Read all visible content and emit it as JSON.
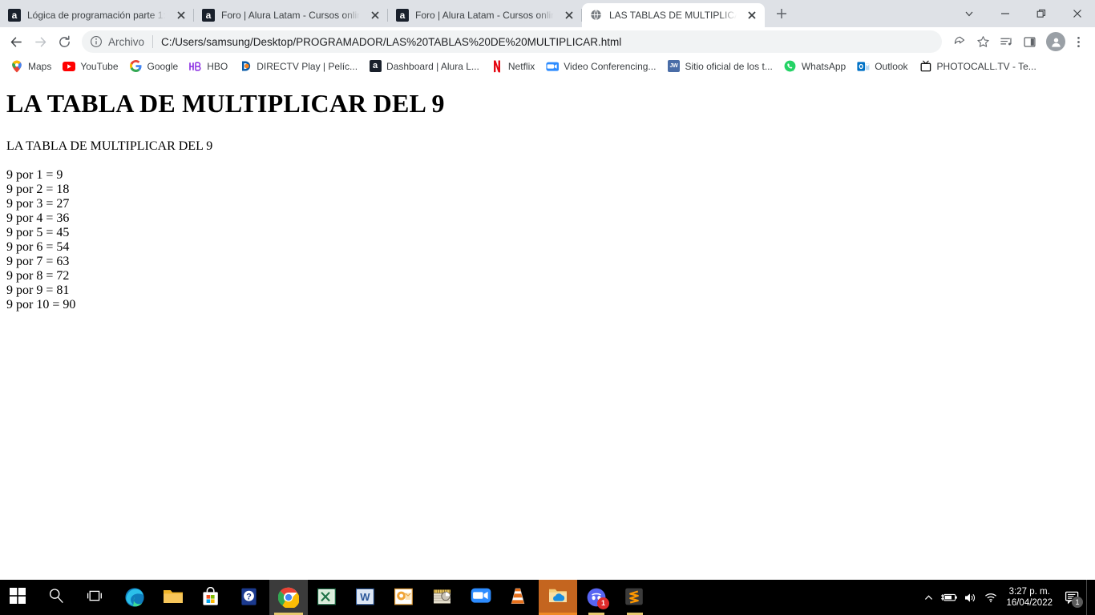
{
  "browser": {
    "tabs": [
      {
        "title": "Lógica de programación parte 1:",
        "favicon": "alura-icon",
        "active": false
      },
      {
        "title": "Foro | Alura Latam - Cursos onlin",
        "favicon": "alura-icon",
        "active": false
      },
      {
        "title": "Foro | Alura Latam - Cursos onlin",
        "favicon": "alura-icon",
        "active": false
      },
      {
        "title": "LAS TABLAS DE MULTIPLICAR.htm",
        "favicon": "globe-icon",
        "active": true
      }
    ],
    "new_tab_tooltip": "Nueva pestaña",
    "window_controls": {
      "more": "chevron-down-icon",
      "minimize": "minimize-icon",
      "restore": "restore-icon",
      "close": "close-icon"
    },
    "toolbar": {
      "back": "back-arrow-icon",
      "forward": "forward-arrow-icon",
      "reload": "reload-icon",
      "omnibox": {
        "info_icon": "info-circle-icon",
        "scheme_label": "Archivo",
        "url": "C:/Users/samsung/Desktop/PROGRAMADOR/LAS%20TABLAS%20DE%20MULTIPLICAR.html"
      },
      "share": "share-icon",
      "bookmark": "star-icon",
      "media": "media-list-icon",
      "sidepanel": "side-panel-icon",
      "profile": "profile-avatar-icon",
      "menu": "three-dot-menu-icon"
    },
    "bookmarks": [
      {
        "label": "Maps",
        "icon": "maps-pin-icon"
      },
      {
        "label": "YouTube",
        "icon": "youtube-icon"
      },
      {
        "label": "Google",
        "icon": "google-g-icon"
      },
      {
        "label": "HBO",
        "icon": "hbo-icon"
      },
      {
        "label": "DIRECTV Play | Pelíc...",
        "icon": "directv-icon"
      },
      {
        "label": "Dashboard | Alura L...",
        "icon": "alura-icon"
      },
      {
        "label": "Netflix",
        "icon": "netflix-n-icon"
      },
      {
        "label": "Video Conferencing...",
        "icon": "zoom-camera-icon"
      },
      {
        "label": "Sitio oficial de los t...",
        "icon": "jw-icon"
      },
      {
        "label": "WhatsApp",
        "icon": "whatsapp-icon"
      },
      {
        "label": "Outlook",
        "icon": "outlook-icon"
      },
      {
        "label": "PHOTOCALL.TV - Te...",
        "icon": "photocall-tv-icon"
      }
    ]
  },
  "page": {
    "heading": "LA TABLA DE MULTIPLICAR DEL 9",
    "subtitle": "LA TABLA DE MULTIPLICAR DEL 9",
    "rows": [
      "9 por 1 = 9",
      "9 por 2 = 18",
      "9 por 3 = 27",
      "9 por 4 = 36",
      "9 por 5 = 45",
      "9 por 6 = 54",
      "9 por 7 = 63",
      "9 por 8 = 72",
      "9 por 9 = 81",
      "9 por 10 = 90"
    ]
  },
  "taskbar": {
    "items": [
      {
        "name": "start-button",
        "icon": "windows-logo-icon",
        "state": "idle"
      },
      {
        "name": "search-button",
        "icon": "search-icon",
        "state": "idle"
      },
      {
        "name": "task-view-button",
        "icon": "task-view-icon",
        "state": "idle"
      },
      {
        "name": "edge-button",
        "icon": "edge-icon",
        "state": "idle"
      },
      {
        "name": "file-explorer-button",
        "icon": "folder-icon",
        "state": "idle"
      },
      {
        "name": "microsoft-store-button",
        "icon": "store-bag-icon",
        "state": "idle"
      },
      {
        "name": "help-button",
        "icon": "help-book-icon",
        "state": "idle"
      },
      {
        "name": "chrome-button",
        "icon": "chrome-icon",
        "state": "active"
      },
      {
        "name": "excel-button",
        "icon": "excel-icon",
        "state": "idle"
      },
      {
        "name": "word-button",
        "icon": "word-icon",
        "state": "idle"
      },
      {
        "name": "outlook-button",
        "icon": "outlook-icon",
        "state": "idle"
      },
      {
        "name": "movie-maker-button",
        "icon": "movie-maker-icon",
        "state": "idle"
      },
      {
        "name": "zoom-button",
        "icon": "zoom-camera-icon",
        "state": "idle"
      },
      {
        "name": "vlc-button",
        "icon": "vlc-cone-icon",
        "state": "idle"
      },
      {
        "name": "onedrive-button",
        "icon": "onedrive-folder-icon",
        "state": "active-highlight"
      },
      {
        "name": "discord-button",
        "icon": "discord-icon",
        "state": "running",
        "badge": "1"
      },
      {
        "name": "sublime-text-button",
        "icon": "sublime-text-icon",
        "state": "running"
      }
    ],
    "tray": {
      "show_hidden": "chevron-up-icon",
      "battery": "battery-charging-icon",
      "volume": "speaker-icon",
      "network": "wifi-icon",
      "time": "3:27 p. m.",
      "date": "16/04/2022",
      "notifications_icon": "notification-icon",
      "notifications_count": "1"
    }
  }
}
